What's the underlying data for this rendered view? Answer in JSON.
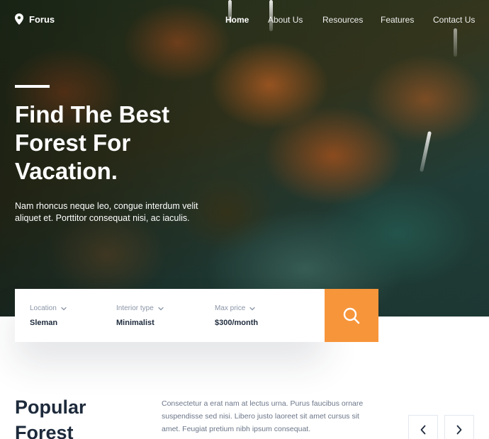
{
  "brand": {
    "name": "Forus",
    "icon": "location-pin-icon"
  },
  "nav": {
    "items": [
      {
        "label": "Home",
        "active": true
      },
      {
        "label": "About Us",
        "active": false
      },
      {
        "label": "Resources",
        "active": false
      },
      {
        "label": "Features",
        "active": false
      },
      {
        "label": "Contact Us",
        "active": false
      }
    ]
  },
  "hero": {
    "title_lines": [
      "Find The Best",
      "Forest For",
      "Vacation."
    ],
    "subtitle": "Nam rhoncus neque leo, congue interdum velit aliquet et. Porttitor consequat nisi, ac iaculis."
  },
  "search": {
    "fields": [
      {
        "label": "Location",
        "value": "Sleman",
        "icon": "chevron-down-icon"
      },
      {
        "label": "Interior type",
        "value": "Minimalist",
        "icon": "chevron-down-icon"
      },
      {
        "label": "Max price",
        "value": "$300/month",
        "icon": "chevron-down-icon"
      }
    ],
    "button_icon": "search-icon",
    "button_color": "#f7953b"
  },
  "popular": {
    "title_lines": [
      "Popular",
      "Forest"
    ],
    "description": "Consectetur a erat nam at lectus urna. Purus faucibus ornare suspendisse sed nisi. Libero justo laoreet sit amet cursus sit amet. Feugiat pretium nibh ipsum consequat.",
    "prev_icon": "chevron-left-icon",
    "next_icon": "chevron-right-icon"
  },
  "colors": {
    "accent": "#f7953b",
    "heading": "#1d2a3b",
    "muted": "#8a94a6"
  }
}
